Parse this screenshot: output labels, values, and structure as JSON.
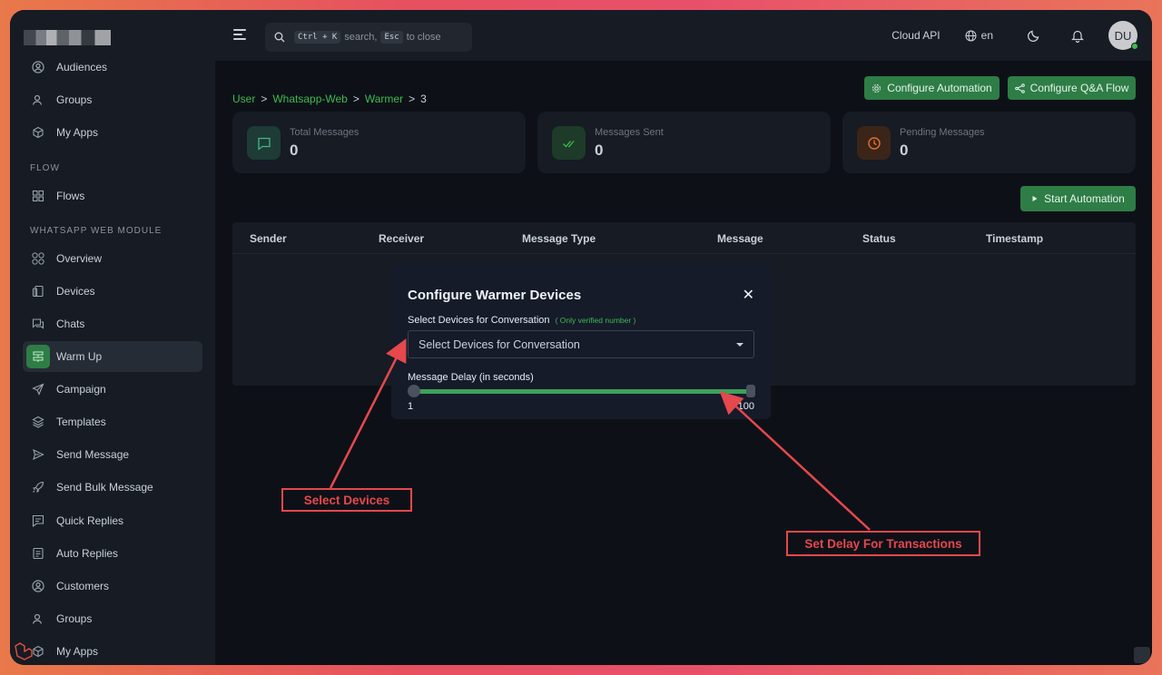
{
  "sidebar": {
    "items_top": [
      {
        "label": "Audiences",
        "icon": "user-circle-icon"
      },
      {
        "label": "Groups",
        "icon": "users-icon"
      },
      {
        "label": "My Apps",
        "icon": "cube-icon"
      }
    ],
    "section_flow": "FLOW",
    "flow_items": [
      {
        "label": "Flows",
        "icon": "grid-icon"
      }
    ],
    "section_whatsapp": "WHATSAPP WEB MODULE",
    "wa_items": [
      {
        "label": "Overview",
        "icon": "overview-icon"
      },
      {
        "label": "Devices",
        "icon": "devices-icon"
      },
      {
        "label": "Chats",
        "icon": "chat-icon"
      },
      {
        "label": "Warm Up",
        "icon": "warmup-icon"
      },
      {
        "label": "Campaign",
        "icon": "send-arrow-icon"
      },
      {
        "label": "Templates",
        "icon": "layers-icon"
      },
      {
        "label": "Send Message",
        "icon": "play-send-icon"
      },
      {
        "label": "Send Bulk Message",
        "icon": "rocket-icon"
      },
      {
        "label": "Quick Replies",
        "icon": "message-square-icon"
      },
      {
        "label": "Auto Replies",
        "icon": "document-icon"
      },
      {
        "label": "Customers",
        "icon": "user-circle-icon"
      },
      {
        "label": "Groups",
        "icon": "users-icon"
      },
      {
        "label": "My Apps",
        "icon": "cube-icon"
      }
    ],
    "active_item": "Warm Up"
  },
  "topbar": {
    "search_key1": "Ctrl + K",
    "search_text1": "search,",
    "search_key2": "Esc",
    "search_text2": "to close",
    "cloud_api": "Cloud API",
    "language": "en",
    "avatar_initials": "DU"
  },
  "breadcrumb": [
    "User",
    "Whatsapp-Web",
    "Warmer",
    "3"
  ],
  "actions": {
    "configure_automation": "Configure Automation",
    "configure_qa_flow": "Configure Q&A Flow",
    "start_automation": "Start Automation"
  },
  "stats": [
    {
      "label": "Total Messages",
      "value": "0",
      "color": "#2e6f5a"
    },
    {
      "label": "Messages Sent",
      "value": "0",
      "color": "#2e7d46"
    },
    {
      "label": "Pending Messages",
      "value": "0",
      "color": "#c2561f"
    }
  ],
  "table": {
    "headers": [
      "Sender",
      "Receiver",
      "Message Type",
      "Message",
      "Status",
      "Timestamp"
    ]
  },
  "modal": {
    "title": "Configure Warmer Devices",
    "close_glyph": "✕",
    "devices_label": "Select Devices for Conversation",
    "devices_note": "( Only verified number )",
    "devices_placeholder": "Select Devices for Conversation",
    "delay_label": "Message Delay (in seconds)",
    "delay_min": "1",
    "delay_max": "100"
  },
  "annotations": {
    "select_devices": "Select Devices",
    "set_delay": "Set Delay For Transactions"
  },
  "colors": {
    "accent": "#2e7d46",
    "callout": "#e5484d",
    "link": "#3fb950"
  }
}
